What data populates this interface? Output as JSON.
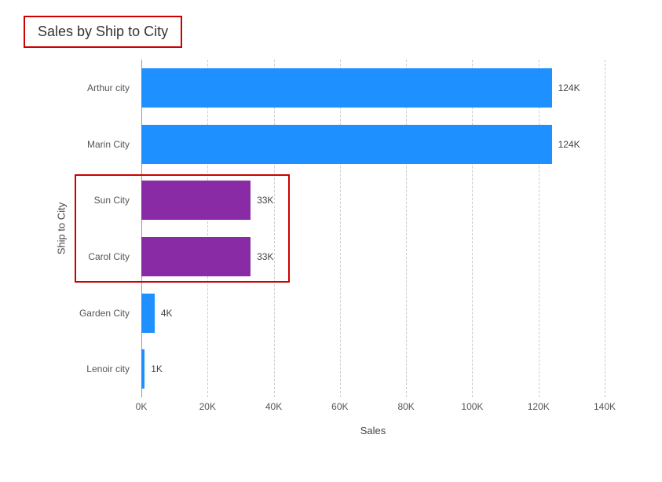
{
  "title": "Sales by Ship to City",
  "ylabel": "Ship to City",
  "xlabel": "Sales",
  "x_ticks": [
    "0K",
    "20K",
    "40K",
    "60K",
    "80K",
    "100K",
    "120K",
    "140K"
  ],
  "bars": [
    {
      "category": "Arthur city",
      "value": 124,
      "label": "124K",
      "color": "#1e90ff"
    },
    {
      "category": "Marin City",
      "value": 124,
      "label": "124K",
      "color": "#1e90ff"
    },
    {
      "category": "Sun City",
      "value": 33,
      "label": "33K",
      "color": "#8a2ba6"
    },
    {
      "category": "Carol City",
      "value": 33,
      "label": "33K",
      "color": "#8a2ba6"
    },
    {
      "category": "Garden City",
      "value": 4,
      "label": "4K",
      "color": "#1e90ff"
    },
    {
      "category": "Lenoir city",
      "value": 1,
      "label": "1K",
      "color": "#1e90ff"
    }
  ],
  "highlight": {
    "start_index": 2,
    "end_index": 3
  },
  "colors": {
    "blue": "#1e90ff",
    "purple": "#8a2ba6",
    "annotation": "#c00"
  },
  "chart_data": {
    "type": "bar",
    "orientation": "horizontal",
    "title": "Sales by Ship to City",
    "xlabel": "Sales",
    "ylabel": "Ship to City",
    "xlim": [
      0,
      140
    ],
    "categories": [
      "Arthur city",
      "Marin City",
      "Sun City",
      "Carol City",
      "Garden City",
      "Lenoir city"
    ],
    "values": [
      124,
      124,
      33,
      33,
      4,
      1
    ],
    "value_unit": "K",
    "series_colors": [
      "#1e90ff",
      "#1e90ff",
      "#8a2ba6",
      "#8a2ba6",
      "#1e90ff",
      "#1e90ff"
    ],
    "highlighted_indices": [
      2,
      3
    ]
  }
}
